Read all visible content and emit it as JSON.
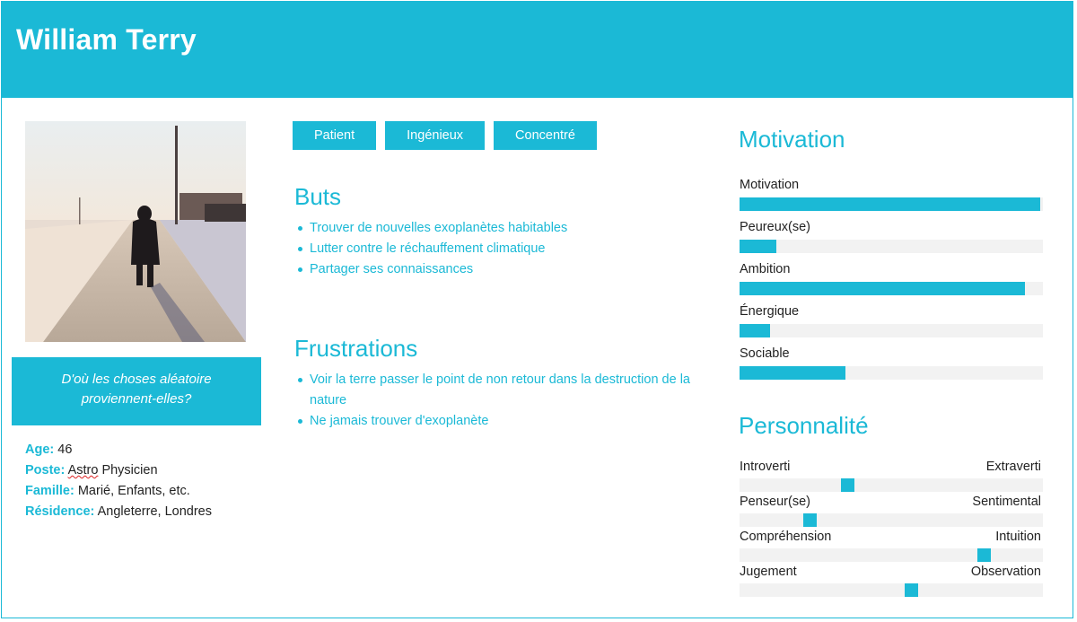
{
  "header": {
    "name": "William Terry"
  },
  "photo": {
    "alt": "Person walking on a snowy road"
  },
  "quote": "D'où les choses aléatoire proviennent-elles?",
  "facts": [
    {
      "key": "Age",
      "value": "46"
    },
    {
      "key": "Poste",
      "value_prefix": "",
      "value_spell": "Astro",
      "value_suffix": " Physicien"
    },
    {
      "key": "Famille",
      "value": "Marié, Enfants, etc."
    },
    {
      "key": "Résidence",
      "value": "Angleterre, Londres"
    }
  ],
  "tags": [
    "Patient",
    "Ingénieux",
    "Concentré"
  ],
  "goals": {
    "title": "Buts",
    "items": [
      "Trouver de nouvelles exoplanètes habitables",
      "Lutter contre le réchauffement climatique",
      "Partager ses connaissances"
    ]
  },
  "frustrations": {
    "title": "Frustrations",
    "items": [
      "Voir la terre passer le point de non retour dans la destruction de la nature",
      "Ne jamais trouver d'exoplanète"
    ]
  },
  "motivation": {
    "title": "Motivation",
    "items": [
      {
        "label": "Motivation",
        "level": 0.99
      },
      {
        "label": "Peureux(se)",
        "level": 0.12
      },
      {
        "label": "Ambition",
        "level": 0.94
      },
      {
        "label": "Énergique",
        "level": 0.1
      },
      {
        "label": "Sociable",
        "level": 0.35
      }
    ]
  },
  "personality": {
    "title": "Personnalité",
    "items": [
      {
        "left": "Introverti",
        "right": "Extraverti",
        "level": 0.35
      },
      {
        "left": "Penseur(se)",
        "right": "Sentimental",
        "level": 0.22
      },
      {
        "left": "Compréhension",
        "right": "Intuition",
        "level": 0.82
      },
      {
        "left": "Jugement",
        "right": "Observation",
        "level": 0.57
      }
    ]
  },
  "colors": {
    "accent": "#1bb9d6",
    "track": "#f2f2f2"
  }
}
